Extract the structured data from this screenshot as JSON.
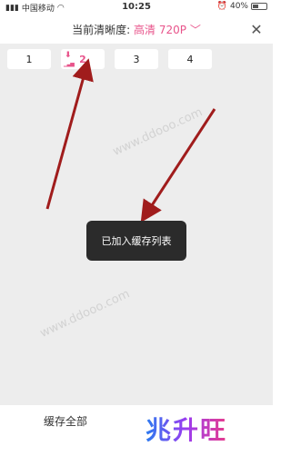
{
  "status": {
    "carrier": "中国移动",
    "time": "10:25",
    "battery": "40%",
    "battery_level": 0.4
  },
  "header": {
    "label": "当前清晰度:",
    "value": "高清 720P",
    "chevron": "chevron-down-icon"
  },
  "episodes": [
    {
      "label": "1",
      "active": false
    },
    {
      "label": "2",
      "active": true
    },
    {
      "label": "3",
      "active": false
    },
    {
      "label": "4",
      "active": false
    }
  ],
  "watermark": "www.ddooo.com",
  "toast": "已加入缓存列表",
  "footer": {
    "save_all": "缓存全部",
    "brand": "兆升旺"
  },
  "colors": {
    "accent": "#e8548b",
    "arrow": "#a01c1c",
    "toast_bg": "#2b2b2b"
  }
}
